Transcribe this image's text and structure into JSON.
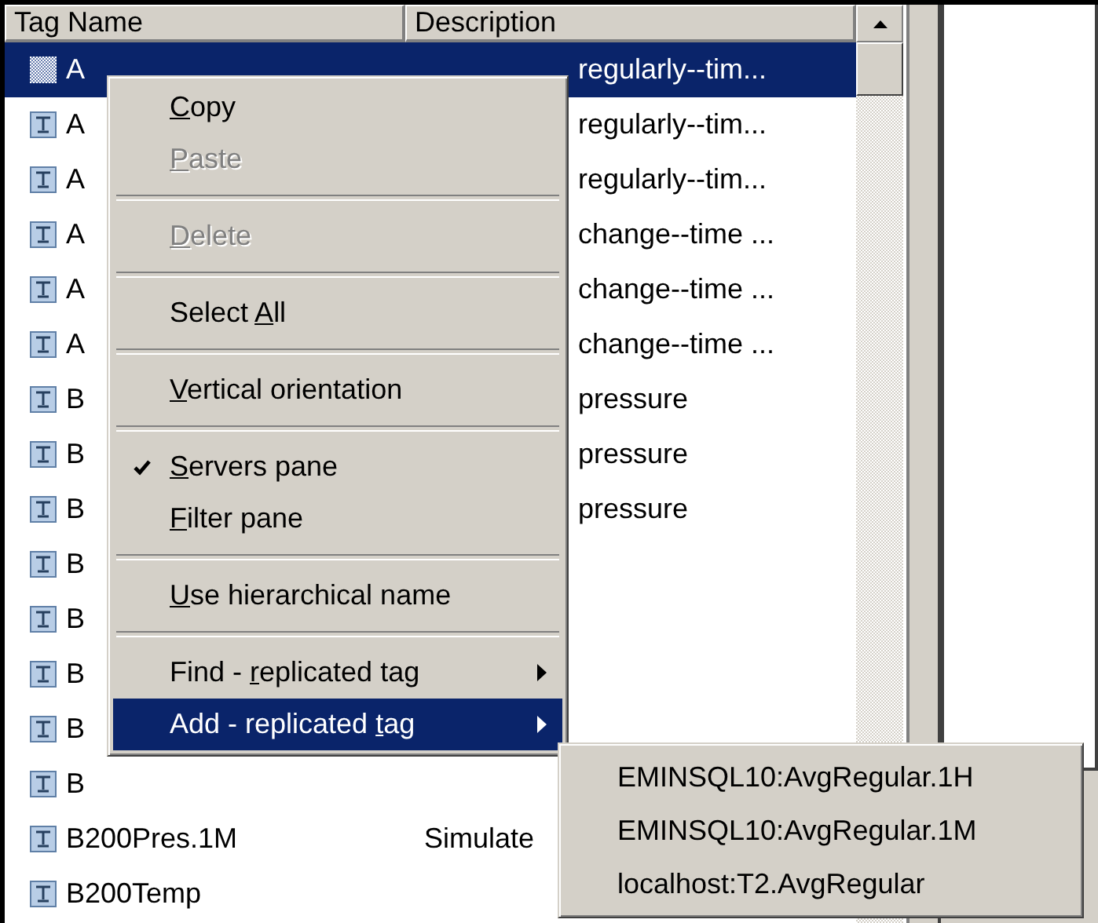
{
  "table": {
    "columns": [
      {
        "label": "Tag Name"
      },
      {
        "label": "Description"
      }
    ],
    "rows": [
      {
        "name": "A",
        "description": "regularly--tim...",
        "selected": true
      },
      {
        "name": "A",
        "description": "regularly--tim...",
        "selected": false
      },
      {
        "name": "A",
        "description": "regularly--tim...",
        "selected": false
      },
      {
        "name": "A",
        "description": "change--time ...",
        "selected": false
      },
      {
        "name": "A",
        "description": "change--time ...",
        "selected": false
      },
      {
        "name": "A",
        "description": "change--time ...",
        "selected": false
      },
      {
        "name": "B",
        "description": "pressure",
        "selected": false
      },
      {
        "name": "B",
        "description": "pressure",
        "selected": false
      },
      {
        "name": "B",
        "description": "pressure",
        "selected": false
      },
      {
        "name": "B",
        "selected": false
      },
      {
        "name": "B",
        "selected": false
      },
      {
        "name": "B",
        "selected": false
      },
      {
        "name": "B",
        "selected": false
      },
      {
        "name": "B",
        "selected": false
      },
      {
        "name": "B200Pres.1M",
        "description": "Simulate",
        "selected": false
      },
      {
        "name": "B200Temp",
        "selected": false
      }
    ]
  },
  "context_menu": {
    "items": [
      {
        "kind": "item",
        "mnemonic": "C",
        "after": "opy",
        "disabled": false,
        "checked": false,
        "has_submenu": false,
        "selected": false
      },
      {
        "kind": "item",
        "mnemonic": "P",
        "after": "aste",
        "disabled": true,
        "checked": false,
        "has_submenu": false,
        "selected": false
      },
      {
        "kind": "separator"
      },
      {
        "kind": "item",
        "mnemonic": "D",
        "after": "elete",
        "disabled": true,
        "checked": false,
        "has_submenu": false,
        "selected": false
      },
      {
        "kind": "separator"
      },
      {
        "kind": "item",
        "before": "Select ",
        "mnemonic": "A",
        "after": "ll",
        "disabled": false,
        "checked": false,
        "has_submenu": false,
        "selected": false
      },
      {
        "kind": "separator"
      },
      {
        "kind": "item",
        "mnemonic": "V",
        "after": "ertical orientation",
        "disabled": false,
        "checked": false,
        "has_submenu": false,
        "selected": false
      },
      {
        "kind": "separator"
      },
      {
        "kind": "item",
        "mnemonic": "S",
        "after": "ervers pane",
        "disabled": false,
        "checked": true,
        "has_submenu": false,
        "selected": false
      },
      {
        "kind": "item",
        "mnemonic": "F",
        "after": "ilter pane",
        "disabled": false,
        "checked": false,
        "has_submenu": false,
        "selected": false
      },
      {
        "kind": "separator"
      },
      {
        "kind": "item",
        "mnemonic": "U",
        "after": "se hierarchical name",
        "disabled": false,
        "checked": false,
        "has_submenu": false,
        "selected": false
      },
      {
        "kind": "separator"
      },
      {
        "kind": "item",
        "before": "Find - ",
        "mnemonic": "r",
        "after": "eplicated tag",
        "disabled": false,
        "checked": false,
        "has_submenu": true,
        "selected": false
      },
      {
        "kind": "item",
        "before": "Add - replicated ",
        "mnemonic": "t",
        "after": "ag",
        "disabled": false,
        "checked": false,
        "has_submenu": true,
        "selected": true
      }
    ]
  },
  "submenu": {
    "items": [
      {
        "label": "EMINSQL10:AvgRegular.1H"
      },
      {
        "label": "EMINSQL10:AvgRegular.1M"
      },
      {
        "label": "localhost:T2.AvgRegular"
      }
    ]
  }
}
